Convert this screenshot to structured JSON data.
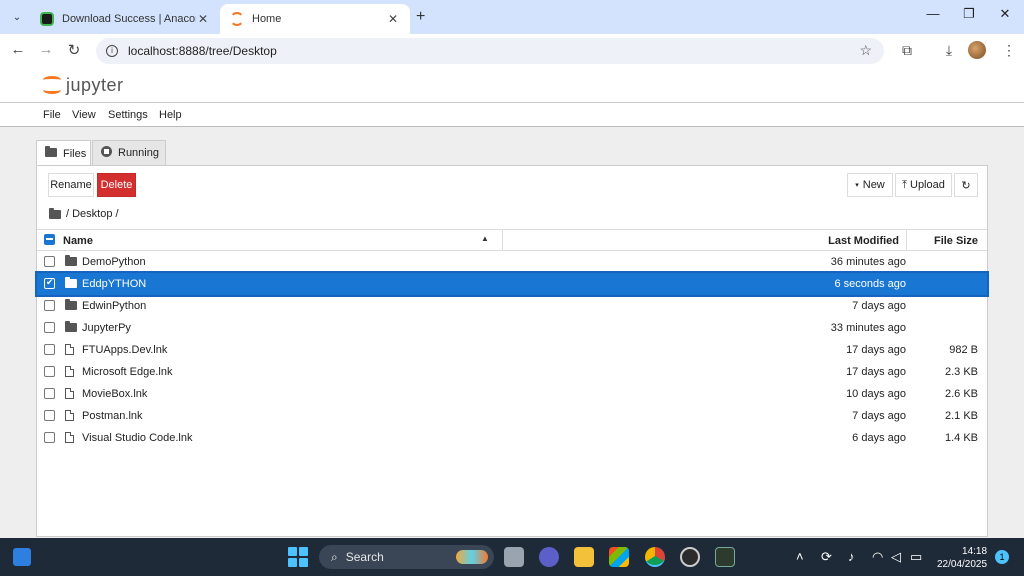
{
  "browser": {
    "tabs": [
      {
        "label": "Download Success | Anaconda",
        "icon": "anaconda-icon"
      },
      {
        "label": "Home",
        "icon": "jupyter-icon",
        "active": true
      }
    ],
    "new_tab": "+",
    "url": "localhost:8888/tree/Desktop",
    "window_controls": {
      "minimize": "—",
      "maximize": "❐",
      "close": "✕"
    },
    "nav": {
      "back": "←",
      "forward": "→",
      "reload": "↻"
    }
  },
  "jupyter": {
    "logo_text": "jupyter",
    "menu": [
      "File",
      "View",
      "Settings",
      "Help"
    ],
    "tabs": [
      {
        "label": "Files",
        "active": true
      },
      {
        "label": "Running",
        "active": false
      }
    ],
    "toolbar": {
      "rename": "Rename",
      "delete": "Delete",
      "new": "New",
      "upload": "Upload",
      "refresh": "↻"
    },
    "breadcrumb": "/ Desktop /",
    "columns": {
      "name": "Name",
      "modified": "Last Modified",
      "size": "File Size"
    },
    "files": [
      {
        "name": "DemoPython",
        "type": "folder",
        "modified": "36 minutes ago",
        "size": "",
        "selected": false
      },
      {
        "name": "EddpYTHON",
        "type": "folder",
        "modified": "6 seconds ago",
        "size": "",
        "selected": true
      },
      {
        "name": "EdwinPython",
        "type": "folder",
        "modified": "7 days ago",
        "size": "",
        "selected": false
      },
      {
        "name": "JupyterPy",
        "type": "folder",
        "modified": "33 minutes ago",
        "size": "",
        "selected": false
      },
      {
        "name": "FTUApps.Dev.lnk",
        "type": "file",
        "modified": "17 days ago",
        "size": "982 B",
        "selected": false
      },
      {
        "name": "Microsoft Edge.lnk",
        "type": "file",
        "modified": "17 days ago",
        "size": "2.3 KB",
        "selected": false
      },
      {
        "name": "MovieBox.lnk",
        "type": "file",
        "modified": "10 days ago",
        "size": "2.6 KB",
        "selected": false
      },
      {
        "name": "Postman.lnk",
        "type": "file",
        "modified": "7 days ago",
        "size": "2.1 KB",
        "selected": false
      },
      {
        "name": "Visual Studio Code.lnk",
        "type": "file",
        "modified": "6 days ago",
        "size": "1.4 KB",
        "selected": false
      }
    ]
  },
  "taskbar": {
    "search": "Search",
    "time": "14:18",
    "date": "22/04/2025",
    "notifications": "1"
  },
  "colors": {
    "accent": "#1976d2",
    "danger": "#d32f2f",
    "jupyter_orange": "#f37726",
    "taskbar": "#1f2a38"
  }
}
